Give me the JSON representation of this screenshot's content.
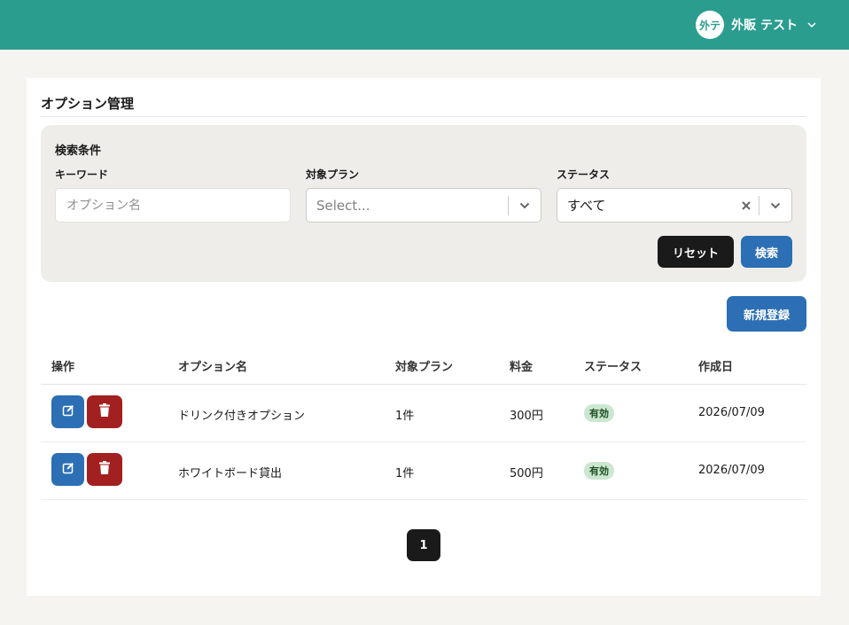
{
  "header": {
    "avatar_text": "外テ",
    "user_name": "外販 テスト",
    "colors": {
      "bar": "#2a9d8f"
    }
  },
  "page": {
    "title": "オプション管理"
  },
  "search": {
    "title": "検索条件",
    "keyword": {
      "label": "キーワード",
      "placeholder": "オプション名",
      "value": ""
    },
    "plan": {
      "label": "対象プラン",
      "placeholder": "Select..."
    },
    "status": {
      "label": "ステータス",
      "value": "すべて"
    },
    "reset_label": "リセット",
    "search_label": "検索"
  },
  "actions": {
    "new_label": "新規登録"
  },
  "table": {
    "columns": [
      "操作",
      "オプション名",
      "対象プラン",
      "料金",
      "ステータス",
      "作成日"
    ],
    "rows": [
      {
        "name": "ドリンク付きオプション",
        "plan": "1件",
        "price": "300円",
        "status": "有効",
        "created": "2026/07/09"
      },
      {
        "name": "ホワイトボード貸出",
        "plan": "1件",
        "price": "500円",
        "status": "有効",
        "created": "2026/07/09"
      }
    ]
  },
  "pagination": {
    "current": "1"
  },
  "icons": {
    "edit": "edit-icon",
    "delete": "trash-icon",
    "clear": "close-icon",
    "dropdown": "chevron-down-icon"
  },
  "colors": {
    "primary": "#2c6fb4",
    "danger": "#a32020",
    "dark": "#1a1a1a",
    "status_badge_bg": "#cbe7cf"
  }
}
